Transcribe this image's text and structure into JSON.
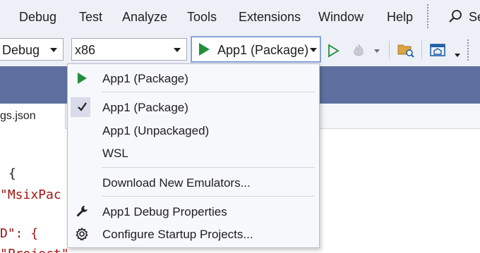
{
  "menu": {
    "items": [
      "Debug",
      "Test",
      "Analyze",
      "Tools",
      "Extensions",
      "Window",
      "Help"
    ],
    "search_label": "Se"
  },
  "toolbar": {
    "config_value": "Debug",
    "platform_value": "x86",
    "startup_value": "App1 (Package)"
  },
  "tab": {
    "label": "gs.json"
  },
  "editor": {
    "lines": [
      "{",
      "\"MsixPac",
      "D\": {",
      "\"Project\""
    ]
  },
  "dropdown": {
    "recent": {
      "label": "App1 (Package)",
      "icon": "play-icon"
    },
    "targets": [
      {
        "label": "App1 (Package)",
        "checked": true
      },
      {
        "label": "App1 (Unpackaged)",
        "checked": false
      },
      {
        "label": "WSL",
        "checked": false
      }
    ],
    "download": "Download New Emulators...",
    "debug_props": {
      "label": "App1 Debug Properties",
      "icon": "wrench-icon"
    },
    "configure": {
      "label": "Configure Startup Projects...",
      "icon": "gear-icon"
    }
  },
  "colors": {
    "accent_green": "#1f8f3a",
    "band_blue": "#5f6f9f",
    "string_red": "#a31515"
  }
}
